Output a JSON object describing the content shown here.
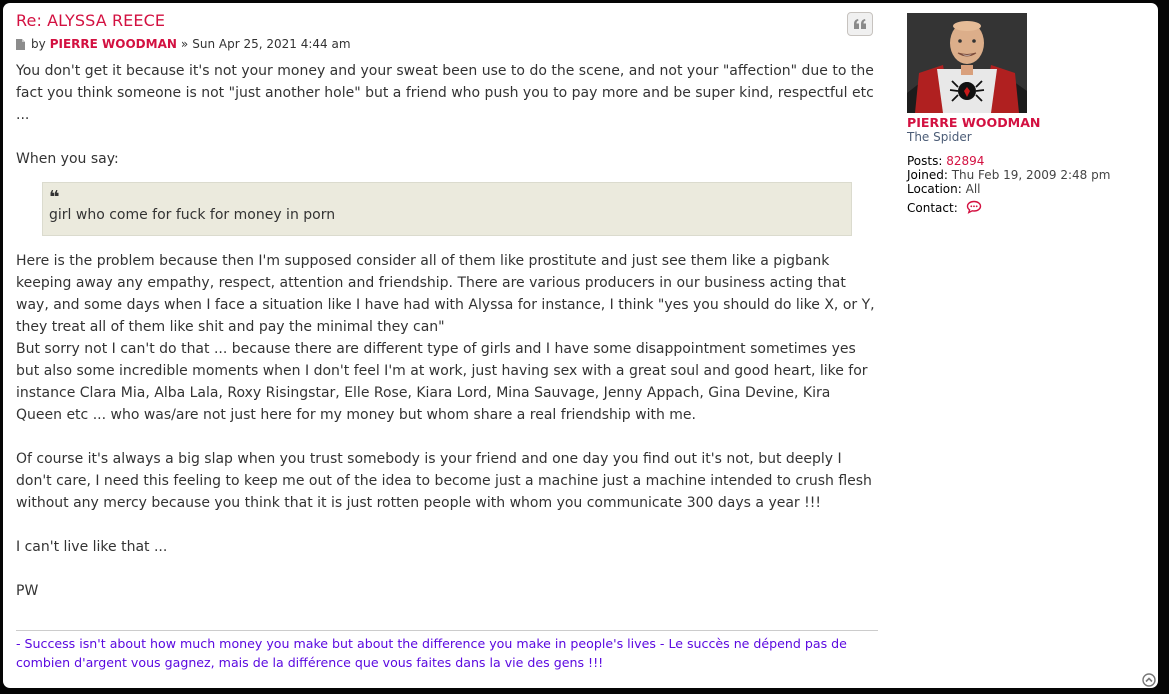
{
  "post": {
    "title": "Re: ALYSSA REECE",
    "by_label": "by",
    "author": "PIERRE WOODMAN",
    "separator": "»",
    "date": "Sun Apr 25, 2021 4:44 am",
    "paragraphs": [
      "You don't get it because it's not your money and your sweat been use to do the scene, and not your \"affection\" due to the fact you think someone is not \"just another hole\" but a friend who push you to pay more and be super kind, respectful etc ...",
      "When you say:"
    ],
    "quote": "girl who come for fuck for money in porn",
    "body_after_quote": [
      "Here is the problem because then I'm supposed consider all of them like prostitute and just see them like a pigbank keeping away any empathy, respect, attention and friendship. There are various producers in our business acting that way, and some days when I face a situation like I have had with Alyssa for instance, I think \"yes you should do like X, or Y, they treat all of them like shit and pay the minimal they can\"",
      "But sorry not I can't do that ... because there are different type of girls and I have some disappointment sometimes yes but also some incredible moments when I don't feel I'm at work, just having sex with a great soul and good heart, like for instance Clara Mia, Alba Lala, Roxy Risingstar, Elle Rose, Kiara Lord, Mina Sauvage, Jenny Appach, Gina Devine, Kira Queen etc ... who was/are not just here for my money but whom share a real friendship with me.",
      "Of course it's always a big slap when you trust somebody is your friend and one day you find out it's not, but deeply I don't care, I need this feeling to keep me out of the idea to become just a machine just a machine intended to crush flesh without any mercy because you think that it is just rotten people with whom you communicate 300 days a year !!!",
      "I can't live like that ...",
      "PW"
    ],
    "signature": "- Success isn't about how much money you make but about the difference you make in people's lives - Le succès ne dépend pas de combien d'argent vous gagnez, mais de la différence que vous faites dans la vie des gens !!!"
  },
  "profile": {
    "name": "PIERRE WOODMAN",
    "rank": "The Spider",
    "posts_label": "Posts:",
    "posts_value": "82894",
    "joined_label": "Joined:",
    "joined_value": "Thu Feb 19, 2009 2:48 pm",
    "location_label": "Location:",
    "location_value": "All",
    "contact_label": "Contact:"
  },
  "icons": {
    "post": "post-icon",
    "quote": "quote-icon",
    "contact": "contact-speech-icon",
    "top": "back-to-top-icon"
  },
  "colors": {
    "accent": "#d31141",
    "signature": "#5b0ae0",
    "quote_bg": "#ebeadd"
  }
}
